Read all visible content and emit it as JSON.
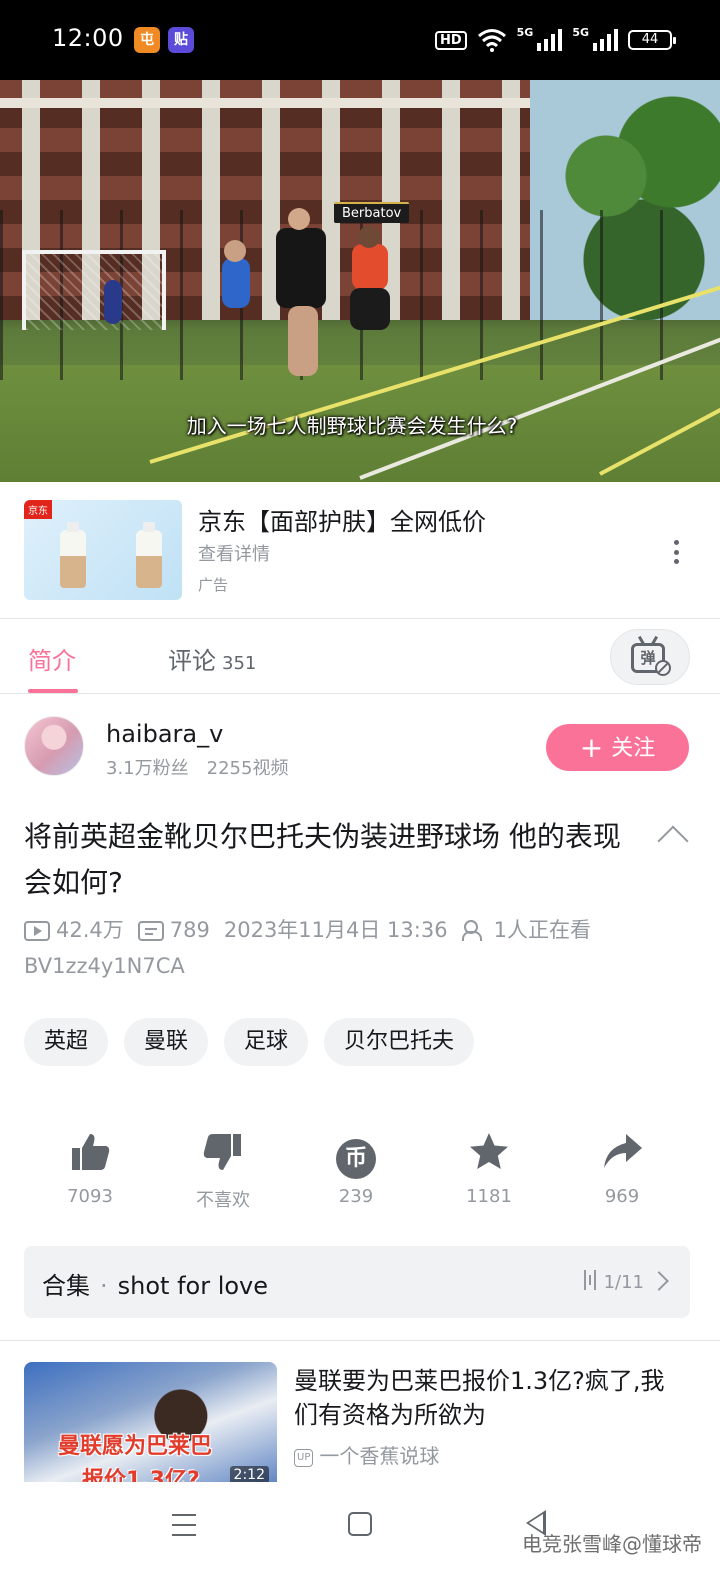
{
  "status_bar": {
    "time": "12:00",
    "app_icon_1": "屯",
    "app_icon_2": "贴",
    "hd_label": "HD",
    "net_1": "5G",
    "net_2": "5G",
    "battery": "44"
  },
  "video": {
    "name_tag": "Berbatov",
    "subtitle": "加入一场七人制野球比赛会发生什么?"
  },
  "ad": {
    "brand_badge": "京东",
    "title": "京东【面部护肤】全网低价",
    "subtitle": "查看详情",
    "tag": "广告"
  },
  "tabs": {
    "intro": "简介",
    "comments": "评论",
    "comments_count": "351",
    "danmaku_icon_text": "弹"
  },
  "uploader": {
    "name": "haibara_v",
    "fans": "3.1万粉丝",
    "videos": "2255视频",
    "follow_label": "关注"
  },
  "video_info": {
    "title": "将前英超金靴贝尔巴托夫伪装进野球场 他的表现会如何?",
    "views": "42.4万",
    "danmaku": "789",
    "date": "2023年11月4日 13:36",
    "watching": "1人正在看",
    "bvid": "BV1zz4y1N7CA"
  },
  "tags": [
    "英超",
    "曼联",
    "足球",
    "贝尔巴托夫"
  ],
  "actions": [
    {
      "icon": "thumbs-up-icon",
      "label": "7093"
    },
    {
      "icon": "thumbs-down-icon",
      "label": "不喜欢"
    },
    {
      "icon": "coin-icon",
      "label": "239"
    },
    {
      "icon": "star-icon",
      "label": "1181"
    },
    {
      "icon": "share-icon",
      "label": "969"
    }
  ],
  "collection": {
    "label": "合集",
    "name": "shot for love",
    "progress": "1/11"
  },
  "related": {
    "thumb_text_1": "曼联愿为巴莱巴",
    "thumb_text_2": "报价1.3亿?",
    "duration": "2:12",
    "title": "曼联要为巴莱巴报价1.3亿?疯了,我们有资格为所欲为",
    "up_badge": "UP",
    "uploader": "一个香蕉说球"
  },
  "watermark": "电竞张雪峰@懂球帝",
  "colors": {
    "accent": "#fb7299",
    "text_secondary": "#9499a0",
    "bg_tag": "#f1f2f3"
  }
}
